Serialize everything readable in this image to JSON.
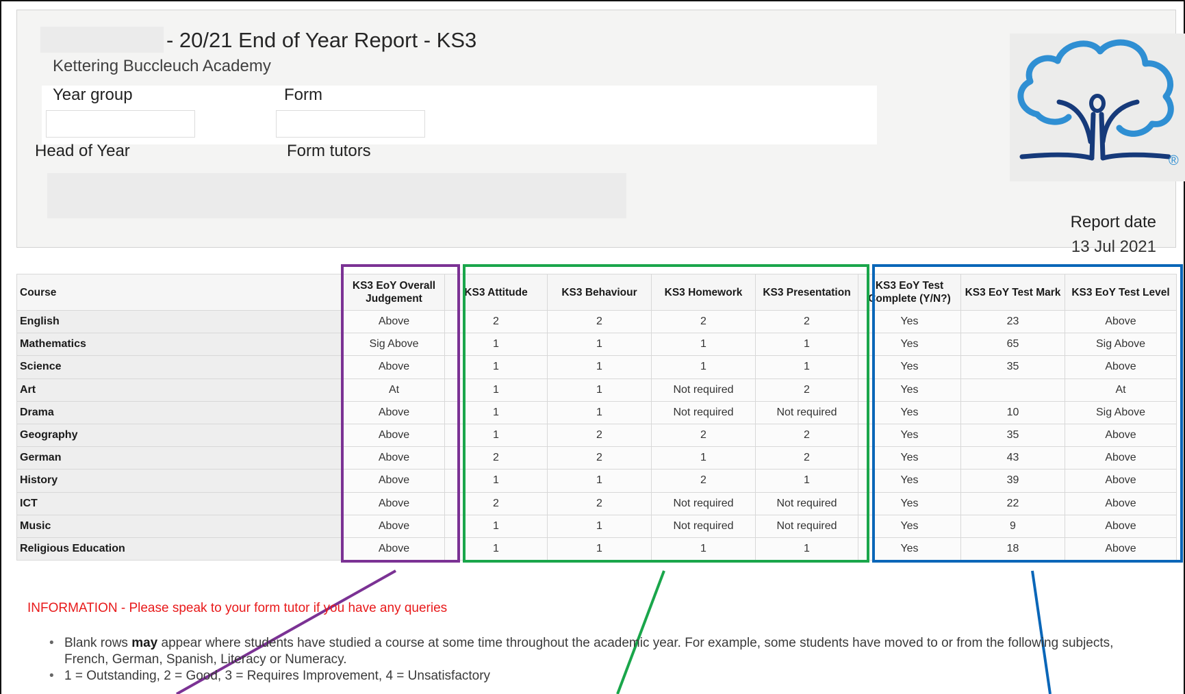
{
  "header": {
    "report_title": "- 20/21 End of Year Report - KS3",
    "school_name": "Kettering Buccleuch Academy",
    "year_group_label": "Year group",
    "form_label": "Form",
    "head_of_year_label": "Head of Year",
    "form_tutors_label": "Form tutors",
    "report_date_label": "Report date",
    "report_date_value": "13 Jul 2021"
  },
  "logo": {
    "icon": "school-tree-logo",
    "registered_mark": "®"
  },
  "table": {
    "columns": [
      "Course",
      "KS3 EoY Overall Judgement",
      "KS3 Attitude",
      "KS3 Behaviour",
      "KS3 Homework",
      "KS3 Presentation",
      "KS3 EoY Test Complete (Y/N?)",
      "KS3 EoY Test Mark",
      "KS3 EoY Test Level"
    ],
    "rows": [
      [
        "English",
        "Above",
        "2",
        "2",
        "2",
        "2",
        "Yes",
        "23",
        "Above"
      ],
      [
        "Mathematics",
        "Sig Above",
        "1",
        "1",
        "1",
        "1",
        "Yes",
        "65",
        "Sig Above"
      ],
      [
        "Science",
        "Above",
        "1",
        "1",
        "1",
        "1",
        "Yes",
        "35",
        "Above"
      ],
      [
        "Art",
        "At",
        "1",
        "1",
        "Not required",
        "2",
        "Yes",
        "",
        "At"
      ],
      [
        "Drama",
        "Above",
        "1",
        "1",
        "Not required",
        "Not required",
        "Yes",
        "10",
        "Sig Above"
      ],
      [
        "Geography",
        "Above",
        "1",
        "2",
        "2",
        "2",
        "Yes",
        "35",
        "Above"
      ],
      [
        "German",
        "Above",
        "2",
        "2",
        "1",
        "2",
        "Yes",
        "43",
        "Above"
      ],
      [
        "History",
        "Above",
        "1",
        "1",
        "2",
        "1",
        "Yes",
        "39",
        "Above"
      ],
      [
        "ICT",
        "Above",
        "2",
        "2",
        "Not required",
        "Not required",
        "Yes",
        "22",
        "Above"
      ],
      [
        "Music",
        "Above",
        "1",
        "1",
        "Not required",
        "Not required",
        "Yes",
        "9",
        "Above"
      ],
      [
        "Religious Education",
        "Above",
        "1",
        "1",
        "1",
        "1",
        "Yes",
        "18",
        "Above"
      ]
    ]
  },
  "highlight_colors": {
    "overall": "#7b3294",
    "attitude_group": "#1aa64b",
    "test_group": "#0a66b8"
  },
  "information": {
    "heading": "INFORMATION - Please speak to your form tutor if you have any queries",
    "bullet1_before": "Blank rows ",
    "bullet1_bold": "may",
    "bullet1_after": " appear where students have studied a course at some time throughout the academic year.  For example, some students have moved to or from the following subjects, French, German, Spanish, Literacy or Numeracy.",
    "bullet2": "1 = Outstanding, 2 = Good, 3 = Requires Improvement, 4 = Unsatisfactory"
  }
}
